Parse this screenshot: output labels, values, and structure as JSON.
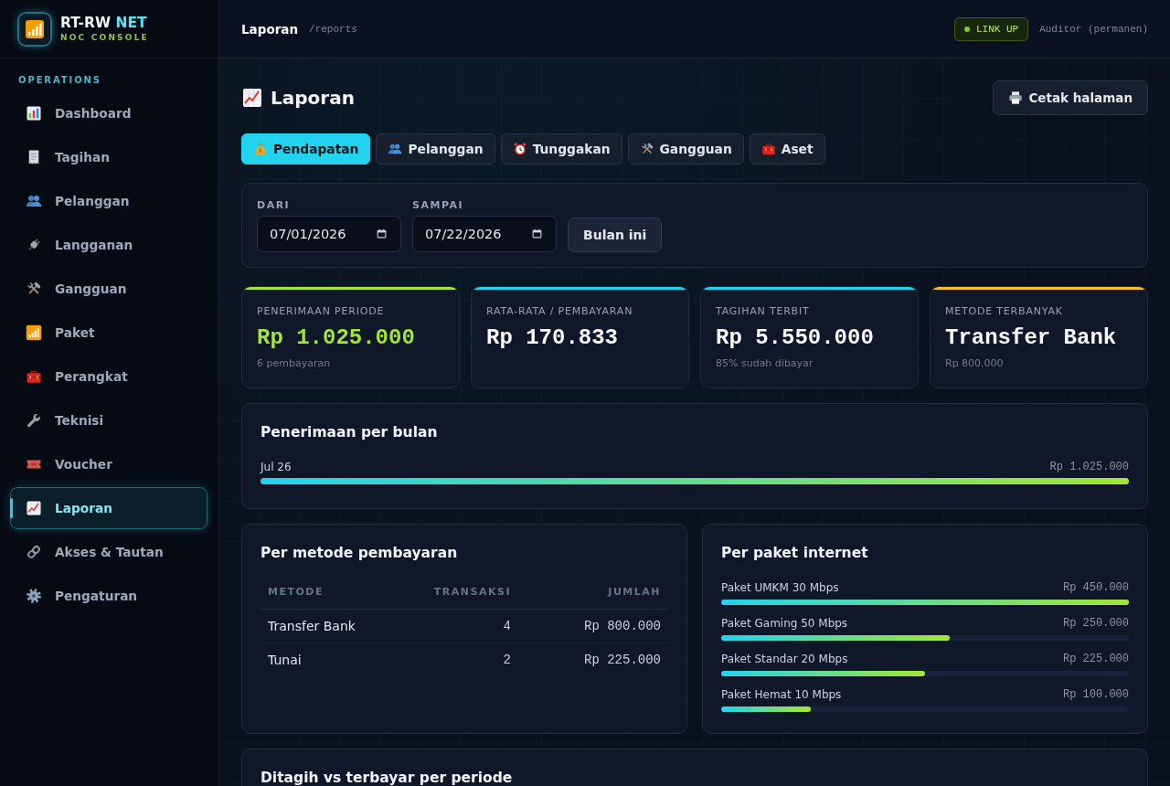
{
  "sidebar": {
    "brand": {
      "name": "RT-RW",
      "name_highlight": "NET",
      "subtitle": "NOC CONSOLE"
    },
    "section_label": "OPERATIONS",
    "items": [
      {
        "label": "Dashboard",
        "selected": false
      },
      {
        "label": "Tagihan",
        "selected": false
      },
      {
        "label": "Pelanggan",
        "selected": false
      },
      {
        "label": "Langganan",
        "selected": false
      },
      {
        "label": "Gangguan",
        "selected": false
      },
      {
        "label": "Paket",
        "selected": false
      },
      {
        "label": "Perangkat",
        "selected": false
      },
      {
        "label": "Teknisi",
        "selected": false
      },
      {
        "label": "Voucher",
        "selected": false
      },
      {
        "label": "Laporan",
        "selected": true
      },
      {
        "label": "Akses & Tautan",
        "selected": false
      },
      {
        "label": "Pengaturan",
        "selected": false
      }
    ]
  },
  "top_bar": {
    "title": "Laporan",
    "path": "/reports",
    "status": "LINK UP",
    "user": "Auditor (permanen)"
  },
  "page": {
    "title": "Laporan",
    "print_button": "Cetak halaman"
  },
  "tabs": [
    {
      "label": "Pendapatan",
      "selected": true
    },
    {
      "label": "Pelanggan",
      "selected": false
    },
    {
      "label": "Tunggakan",
      "selected": false
    },
    {
      "label": "Gangguan",
      "selected": false
    },
    {
      "label": "Aset",
      "selected": false
    }
  ],
  "filter": {
    "from": {
      "label": "DARI",
      "value": "07/01/2026"
    },
    "to": {
      "label": "SAMPAI",
      "value": "07/22/2026"
    },
    "button": "Bulan ini"
  },
  "stats": [
    {
      "label": "PENERIMAAN PERIODE",
      "value": "Rp 1.025.000",
      "note": "6 pembayaran",
      "color": "#a3e635",
      "highlight": true
    },
    {
      "label": "RATA-RATA / PEMBAYARAN",
      "value": "Rp 170.833",
      "color": "#22d3ee",
      "highlight": false
    },
    {
      "label": "TAGIHAN TERBIT",
      "value": "Rp 5.550.000",
      "note": "85% sudah dibayar",
      "color": "#22d3ee",
      "highlight": false
    },
    {
      "label": "METODE TERBANYAK",
      "value": "Transfer Bank",
      "note": "Rp 800.000",
      "color": "#fbbf24",
      "highlight": false
    }
  ],
  "monthly": {
    "title": "Penerimaan per bulan",
    "rows": [
      {
        "label": "Jul 26",
        "amount": "Rp 1.025.000",
        "level": 1
      }
    ]
  },
  "by_method": {
    "title": "Per metode pembayaran",
    "columns": [
      "METODE",
      "TRANSAKSI",
      "JUMLAH"
    ],
    "rows": [
      [
        "Transfer Bank",
        "4",
        "Rp 800.000"
      ],
      [
        "Tunai",
        "2",
        "Rp 225.000"
      ]
    ]
  },
  "by_package": {
    "title": "Per paket internet",
    "rows": [
      {
        "label": "Paket UMKM 30 Mbps",
        "amount": "Rp 450.000",
        "level": 1
      },
      {
        "label": "Paket Gaming 50 Mbps",
        "amount": "Rp 250.000",
        "level": 0.56
      },
      {
        "label": "Paket Standar 20 Mbps",
        "amount": "Rp 225.000",
        "level": 0.5
      },
      {
        "label": "Paket Hemat 10 Mbps",
        "amount": "Rp 100.000",
        "level": 0.22
      }
    ]
  },
  "billed_vs_paid": {
    "title": "Ditagih vs terbayar per periode"
  }
}
